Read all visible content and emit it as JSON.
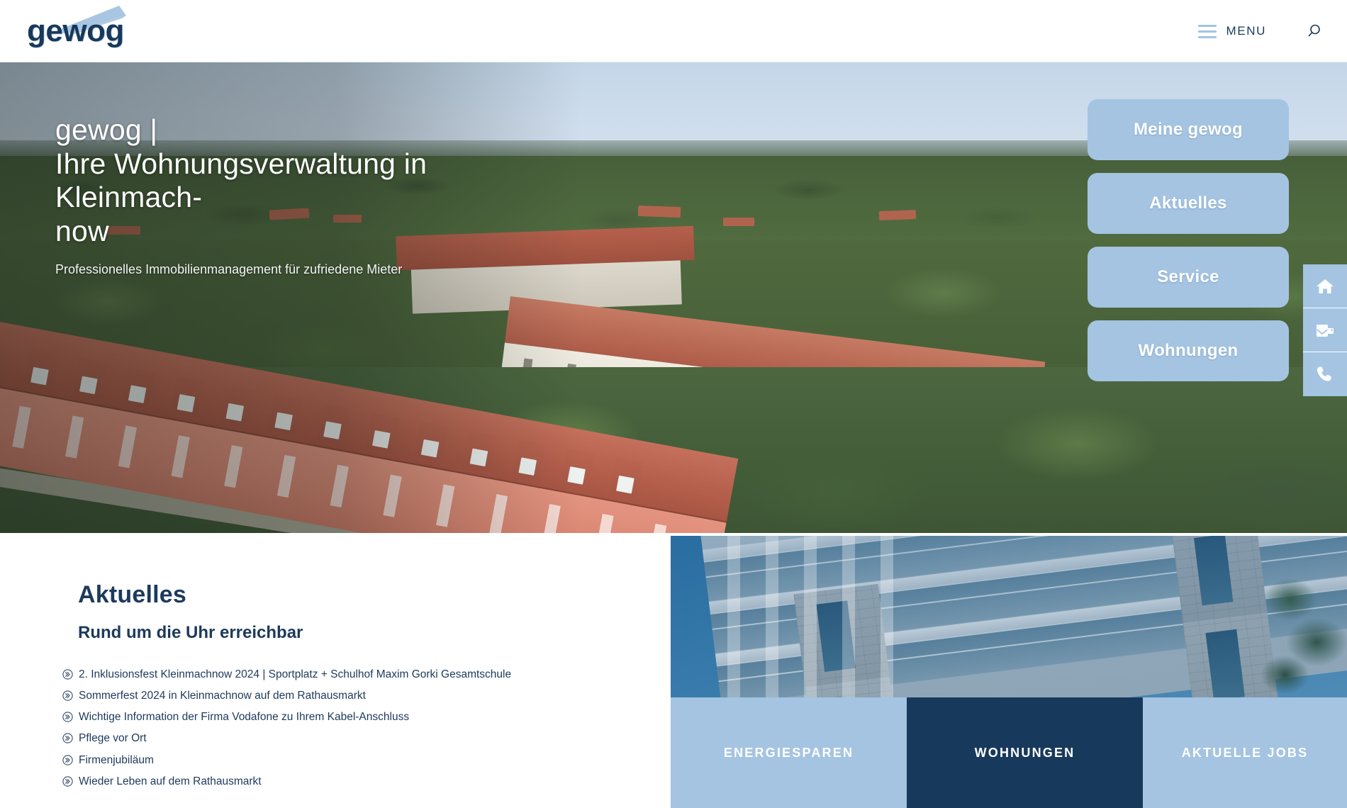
{
  "brand": {
    "logo_text": "gewog",
    "logo_roof_icon": "roof-swoosh-icon"
  },
  "header": {
    "menu_label": "MENU",
    "menu_icon": "hamburger-icon",
    "search_icon": "search-icon"
  },
  "hero": {
    "title_line1": "gewog |",
    "title_line2": "Ihre Wohnungsverwaltung in Kleinmach-",
    "title_line3": "now",
    "subtitle": "Professionelles Immobilienmanagement für zufriedene Mieter",
    "cta_buttons": [
      {
        "label": "Meine gewog"
      },
      {
        "label": "Aktuelles"
      },
      {
        "label": "Service"
      },
      {
        "label": "Wohnungen"
      }
    ]
  },
  "icon_rail": [
    {
      "name": "home-icon"
    },
    {
      "name": "mail-icon"
    },
    {
      "name": "phone-icon"
    }
  ],
  "news": {
    "heading": "Aktuelles",
    "subheading": "Rund um die Uhr erreichbar",
    "bullet_icon": "circle-double-chevron-icon",
    "items": [
      {
        "text": "2. Inklusionsfest Kleinmachnow 2024 | Sportplatz + Schulhof Maxim Gorki Gesamtschule"
      },
      {
        "text": "Sommerfest 2024 in Kleinmachnow auf dem Rathausmarkt"
      },
      {
        "text": "Wichtige Information der Firma Vodafone zu Ihrem Kabel-Anschluss"
      },
      {
        "text": "Pflege vor Ort"
      },
      {
        "text": "Firmenjubiläum"
      },
      {
        "text": "Wieder Leben auf dem Rathausmarkt"
      }
    ]
  },
  "promo": {
    "tiles": [
      {
        "label": "ENERGIESPAREN"
      },
      {
        "label": "WOHNUNGEN"
      },
      {
        "label": "AKTUELLE JOBS"
      }
    ]
  },
  "colors": {
    "brand_navy": "#17395b",
    "brand_light_blue": "#a4c4e2",
    "heading_navy": "#1d3a5c",
    "white": "#ffffff"
  }
}
